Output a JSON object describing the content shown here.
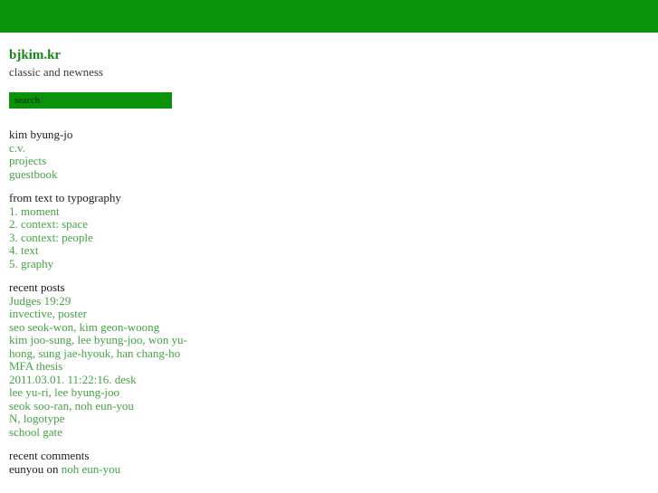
{
  "topbar": {
    "color": "#099409"
  },
  "site": {
    "title": "bjkim.kr",
    "tagline": "classic and newness"
  },
  "search": {
    "placeholder": "search",
    "value": ""
  },
  "nav_section": {
    "heading": "kim byung-jo",
    "items": [
      {
        "label": "c.v."
      },
      {
        "label": "projects"
      },
      {
        "label": "guestbook"
      }
    ]
  },
  "series_section": {
    "heading": "from text to typography",
    "items": [
      {
        "label": "1. moment"
      },
      {
        "label": "2. context: space"
      },
      {
        "label": "3. context: people"
      },
      {
        "label": "4. text"
      },
      {
        "label": "5. graphy"
      }
    ]
  },
  "posts_section": {
    "heading": "recent posts",
    "items": [
      {
        "label": "Judges 19:29"
      },
      {
        "label": "invective, poster"
      },
      {
        "label": "seo seok-won, kim geon-woong"
      },
      {
        "label": "kim joo-sung, lee byung-joo, won yu-hong, sung jae-hyouk, han chang-ho"
      },
      {
        "label": "MFA thesis"
      },
      {
        "label": "2011.03.01. 11:22:16. desk"
      },
      {
        "label": "lee yu-ri, lee byung-joo"
      },
      {
        "label": "seok soo-ran, noh eun-you"
      },
      {
        "label": "N, logotype"
      },
      {
        "label": "school gate"
      }
    ]
  },
  "comments_section": {
    "heading": "recent comments",
    "items": [
      {
        "author": "eunyou",
        "connector": " on ",
        "post": "noh eun-you"
      }
    ]
  },
  "colors": {
    "brand_green": "#099409",
    "link_green": "#45a245",
    "title_green": "#128a12",
    "text_dark": "#1c1c1c",
    "tagline_gray": "#3a3a3a",
    "background": "#ffffff"
  }
}
